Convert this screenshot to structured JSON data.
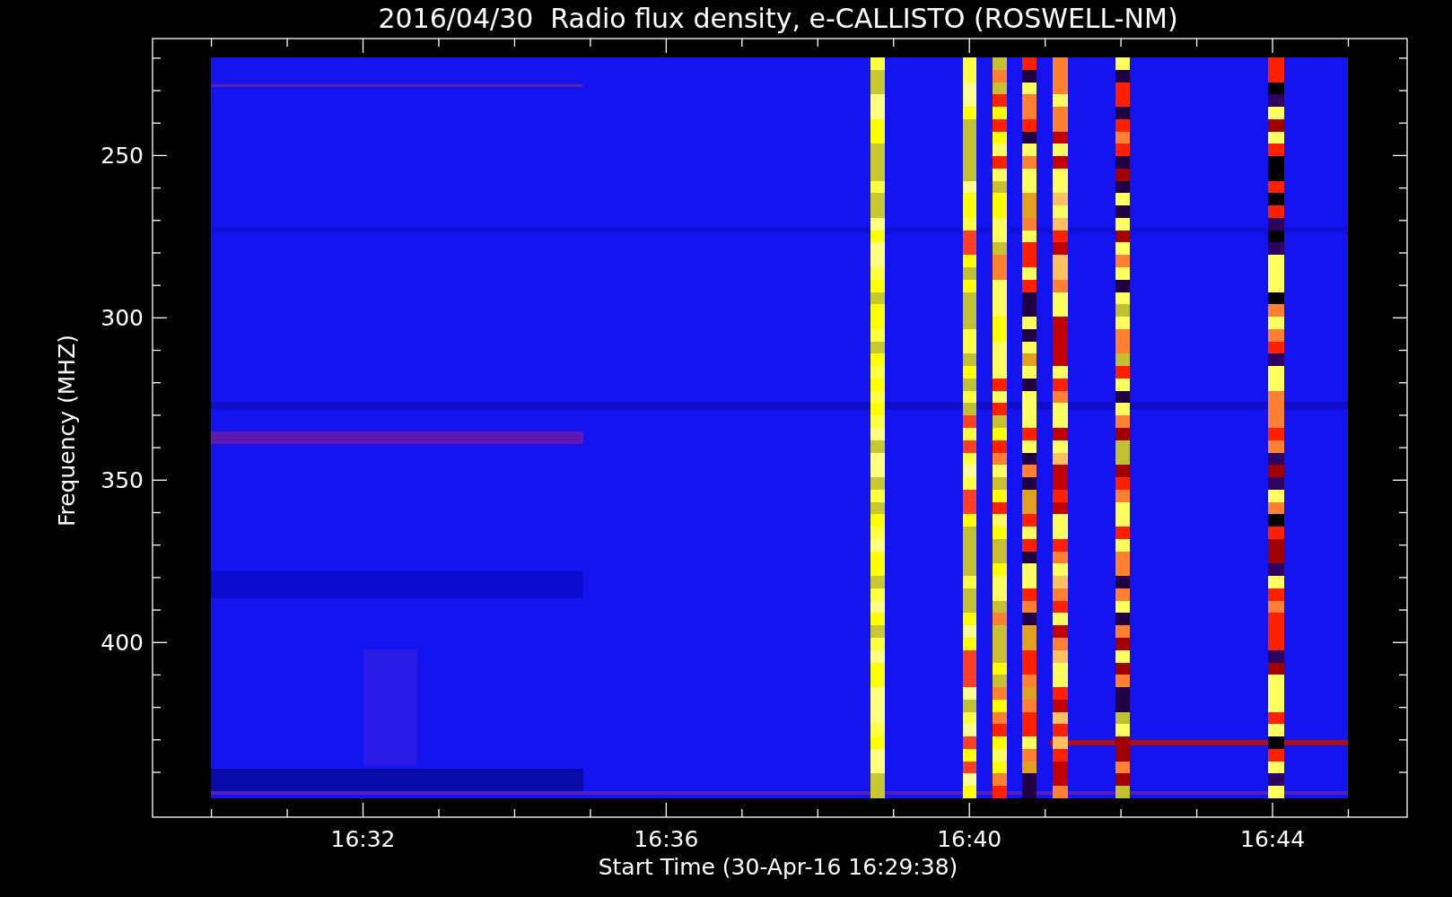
{
  "chart": {
    "title": "2016/04/30  Radio flux density, e-CALLISTO (ROSWELL-NM)",
    "ylabel": "Frequency (MHZ)",
    "xlabel": "Start Time (30-Apr-16 16:29:38)",
    "y_tick_labels": [
      "250",
      "300",
      "350",
      "400"
    ],
    "x_tick_labels": [
      "16:32",
      "16:36",
      "16:40",
      "16:44"
    ]
  }
}
